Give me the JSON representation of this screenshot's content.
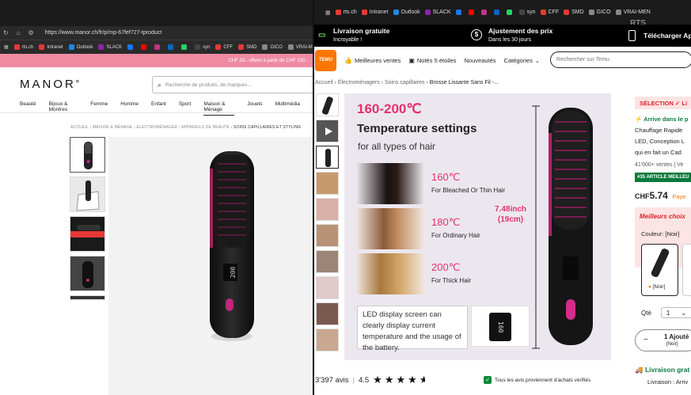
{
  "left": {
    "url": "https://www.manor.ch/fr/p/mp-67fef727-tproduct",
    "bookmarks": [
      {
        "label": "rts.ch",
        "color": "#e53935"
      },
      {
        "label": "Intranet",
        "color": "#e53935"
      },
      {
        "label": "Outlook",
        "color": "#1e88e5"
      },
      {
        "label": "SLACK",
        "color": "#8e24aa"
      },
      {
        "label": "",
        "color": "#1877f2"
      },
      {
        "label": "",
        "color": "#ff0000"
      },
      {
        "label": "",
        "color": "#c13584"
      },
      {
        "label": "",
        "color": "#0a66c2"
      },
      {
        "label": "",
        "color": "#25d366"
      },
      {
        "label": "syn",
        "color": "#444444"
      },
      {
        "label": "CFF",
        "color": "#e53935"
      },
      {
        "label": "SMD",
        "color": "#e53935"
      },
      {
        "label": "GICO",
        "color": "#888888"
      },
      {
        "label": "VRAI-MEN",
        "color": "#888888"
      }
    ],
    "promo": "CHF 20.- offerts à partir de CHF 100.-",
    "logo": "MANOR",
    "search_placeholder": "Recherche de produits, de marques...",
    "menu": [
      "Beauté",
      "Bijoux & Montres",
      "Femme",
      "Homme",
      "Enfant",
      "Sport",
      "Maison & Ménage",
      "Jouets",
      "Multimédia"
    ],
    "menu_active_index": 6,
    "breadcrumb": [
      "ACCUEIL",
      "MAISON & MÉNAGE",
      "ELECTROMÉNAGER",
      "APPAREILS DE BEAUTÉ",
      "SOINS CAPILLAIRES ET STYLING"
    ]
  },
  "right": {
    "bookmarks": [
      {
        "label": "rts.ch",
        "color": "#e53935"
      },
      {
        "label": "Intranet",
        "color": "#e53935"
      },
      {
        "label": "Outlook",
        "color": "#1e88e5"
      },
      {
        "label": "SLACK",
        "color": "#8e24aa"
      },
      {
        "label": "",
        "color": "#1877f2"
      },
      {
        "label": "",
        "color": "#ff0000"
      },
      {
        "label": "",
        "color": "#c13584"
      },
      {
        "label": "",
        "color": "#0a66c2"
      },
      {
        "label": "",
        "color": "#25d366"
      },
      {
        "label": "syn",
        "color": "#444444"
      },
      {
        "label": "CFF",
        "color": "#e53935"
      },
      {
        "label": "SMD",
        "color": "#e53935"
      },
      {
        "label": "GICO",
        "color": "#888888"
      },
      {
        "label": "VRAI-MEN",
        "color": "#888888"
      }
    ],
    "watermark": "RTS",
    "shipping": {
      "title": "Livraison gratuite",
      "title_sub": "Incroyable !",
      "adjust": "Ajustement des prix",
      "adjust_sub": "Dans les 30 jours",
      "download": "Télécharger Ap"
    },
    "nav": {
      "logo": "TEMU",
      "items": [
        "Meilleures ventes",
        "Notés 5 étoiles",
        "Nouveautés",
        "Catégories"
      ],
      "search_placeholder": "Rechercher sur Temu"
    },
    "breadcrumb": [
      "Accueil",
      "Électroménagers",
      "Soins capillaires",
      "Brosse Lissante Sans Fil -..."
    ],
    "hero": {
      "range": "160-200℃",
      "title": "Temperature settings",
      "subtitle": "for all types of hair",
      "temps": [
        {
          "t": "160℃",
          "d": "For Bleached Or Thin Hair"
        },
        {
          "t": "180℃",
          "d": "For Ordinary Hair"
        },
        {
          "t": "200℃",
          "d": "For Thick Hair"
        }
      ],
      "dim1": "7.48inch",
      "dim2": "(19cm)",
      "led": "LED display screen can clearly display current temperature and the usage of the battery.",
      "screen_value": "160"
    },
    "reviews_count": "3'397 avis",
    "rating": "4.5",
    "verified": "Tous les avis proviennent d'achats vérifiés",
    "side": {
      "selection": "SÉLECTION ✓ Li",
      "arrive": "Arrive dans le p",
      "desc1": "Chauffage Rapide",
      "desc2": "LED, Conception L",
      "desc3": "qui en fait un Cad",
      "sales": "41'000+ ventes | Ve",
      "badge": "#35 ARTICLE MEILLEU",
      "price_currency": "CHF",
      "price": "5.74",
      "pay": "Paye",
      "best": "Meilleurs choix",
      "color_label": "Couleur: [Noir]",
      "swatch_label": "[Noir]",
      "qty_label": "Qté",
      "qty_value": "1",
      "add_minus": "−",
      "add_label": "1 Ajouté",
      "add_sub": "[Noir]",
      "ship": "Livraison grat",
      "ship2": "Livraison : Arriv"
    }
  }
}
